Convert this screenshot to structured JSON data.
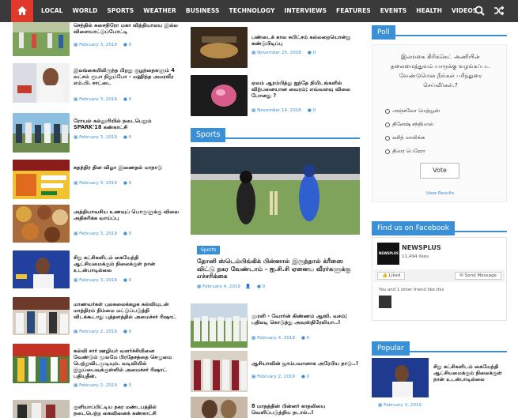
{
  "nav": {
    "items": [
      "LOCAL",
      "WORLD",
      "SPORTS",
      "WEATHER",
      "BUSINESS",
      "TECHNOLOGY",
      "INTERVIEWS",
      "FEATURES",
      "EVENTS",
      "HEALTH",
      "VIDEOS"
    ]
  },
  "left_list": [
    {
      "title": "செந்தில் சுசைநிரோ மகா வித்தியாலய இல்ல விளையாட்டுப்போட்டி",
      "date": "February 3, 2019",
      "comments": "0"
    },
    {
      "title": "இலங்கையிலிருந்த பிறது குழந்தைகளும் 4 லட்சம் ரூபா நிறுப்போ - மஹிந்த அமரவீர எம்.பி. சாட்டை",
      "date": "February 3, 2019",
      "comments": "0"
    },
    {
      "title": "ரோயல் கல்லூரியில் நடைபெறும் SPARK'18 கண்காட்சி",
      "date": "February 3, 2019",
      "comments": "0"
    },
    {
      "title": "சுதந்திர தின விழா இணைதல் மாநாடு",
      "date": "February 3, 2019",
      "comments": "0"
    },
    {
      "title": "அத்தியாவசிய உணவுப் பொருளுக்கு விலை அதிகரிக்க வாய்ப்பு",
      "date": "February 3, 2019",
      "comments": "0"
    },
    {
      "title": "சிறு கட்சிகளிடம் கையேந்தி ஆட்சியமைக்கும் நிலைக்குள் நான் உடன்பாடில்லை",
      "date": "February 3, 2019",
      "comments": "0"
    },
    {
      "title": "மாணவர்கள் புலகலைக்கழக கல்வியுடன் மாத்திரம் நிம்மை மட்டுப்படுத்தி விடக்கூடாது புத்தளத்தில் அமைச்சர் ரிஷாட்",
      "date": "February 2, 2019",
      "comments": "0"
    },
    {
      "title": "கல்வி சார் ஊழியர் வளர்ச்சியினை வேண்டும் மூலமே பிரதேசத்தை செழுமை பெற்றுவிடமுடியும். வடிவியில் இறுப்பைவுக்குள்ளில் அமைச்சர் ரிஷாட் பதியுதீன்.",
      "date": "February 2, 2019",
      "comments": "0"
    },
    {
      "title": "குளியாப்பிட்டிய நகர மண்டபத்தில் நடைபெற்ற கைவினைக் கண்காட்சி",
      "date": "",
      "comments": ""
    }
  ],
  "middle_top": [
    {
      "title": "பண்டைக் கால சுபிட்சம் கல்லறையொன்று கண்டுபிடிப்பு",
      "date": "November 25, 2018",
      "comments": "0"
    },
    {
      "title": "ஏலம் ஆரம்பித்து ஐந்தே நிமிடங்களில் விற்பனையான வைரம்; எவ்வளவு விலை போனது ?",
      "date": "November 14, 2018",
      "comments": "0"
    }
  ],
  "sports": {
    "heading": "Sports",
    "featured": {
      "tag": "Sports",
      "title": "தோனி ஸ்டெம்பிங்கிக் பின்னால் இருந்தால் க்ரீஸை விட்டு நகர வேண்டாம் - ஐ.சி.சி ஏனைய வீரர்களுக்கு எச்சரிக்கை",
      "date": "February 4, 2019",
      "comments": "0"
    },
    "list": [
      {
        "title": "முரளி - வோர்ன் கிண்ணம் ஆஸி. வசம்; பதிலடி கொடுத்து அவுஸ்திரேலியா..!",
        "date": "February 4, 2019",
        "comments": "0"
      },
      {
        "title": "ஆசியாவின் ஜாம்பவானாக அரேபிய நாடு..!",
        "date": "February 2, 2019",
        "comments": "0"
      },
      {
        "title": "8 மாதத்தின் பின்னர் காதலியை வெளிப்படுத்திய நடால்..!",
        "date": "",
        "comments": ""
      }
    ]
  },
  "poll": {
    "heading": "Poll",
    "question": "இலங்கை கிரிக்கெட் அணியின் தலைமைத்துவம் யாருக்கு வழங்கப்பட வேண்டுமென நீங்கள் பரிந்துரை செய்வீர்கள்.?",
    "options": [
      "அஞ்சலோ மெத்யூஸ்",
      "தினேஷ் சந்திமால்",
      "லசித் மாலிங்க",
      "திஸர பெரேரா"
    ],
    "vote_label": "Vote",
    "results_label": "View Results"
  },
  "facebook": {
    "heading": "Find us on Facebook",
    "page_name": "NEWSPLUS",
    "likes": "11,494 likes",
    "like_label": "Liked",
    "send_label": "Send Message",
    "friends_text": "You and 1 other friend like this",
    "logo_text": "NEWSPLUS"
  },
  "popular": {
    "heading": "Popular",
    "title": "சிறு கட்சிகளிடம் கையேந்தி ஆட்சியமைக்கும் நிலைக்குள் நான் உடன்பாடில்லை",
    "date": "February 3, 2019"
  },
  "colors": {
    "accent": "#3b8fd4",
    "nav": "#3a3a3a",
    "home": "#e0392b"
  }
}
